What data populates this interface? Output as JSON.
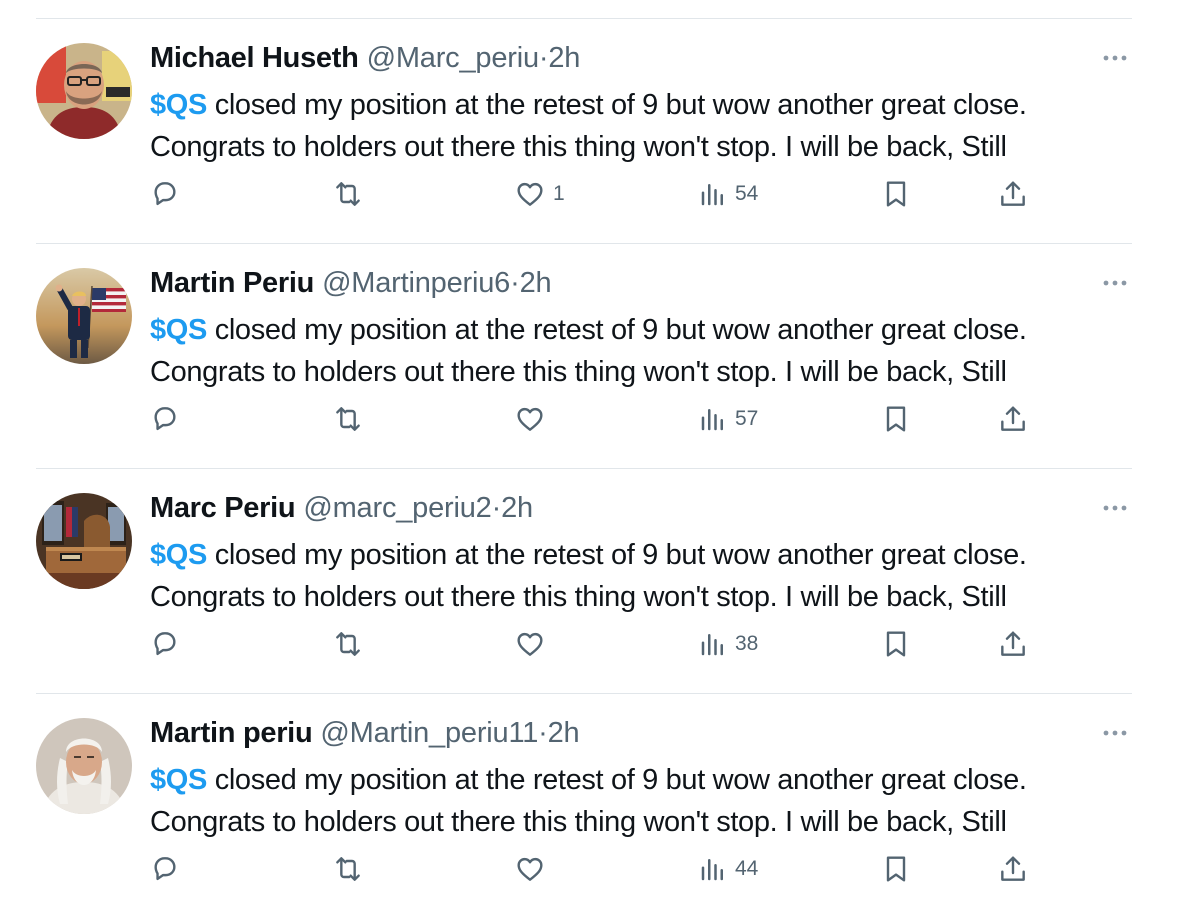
{
  "colors": {
    "accent": "#1d9bf0",
    "text": "#0f1419",
    "secondary": "#536471",
    "divider": "#e1e6ea"
  },
  "tweets": [
    {
      "name": "Michael Huseth",
      "handle": "@Marc_periu",
      "separator": "·",
      "time": "2h",
      "cashtag": "$QS",
      "text_line1": " closed my position at the retest of 9 but wow another great close.",
      "text_line2": "Congrats to holders out there this thing won't stop. I will be back, Still",
      "likes": "1",
      "views": "54",
      "avatar_icon": "avatar-man-glasses"
    },
    {
      "name": "Martin Periu",
      "handle": "@Martinperiu6",
      "separator": "·",
      "time": "2h",
      "cashtag": "$QS",
      "text_line1": " closed my position at the retest of 9 but wow another great close.",
      "text_line2": "Congrats to holders out there this thing won't stop. I will be back, Still",
      "likes": "",
      "views": "57",
      "avatar_icon": "avatar-man-with-flag"
    },
    {
      "name": "Marc Periu",
      "handle": "@marc_periu2",
      "separator": "·",
      "time": "2h",
      "cashtag": "$QS",
      "text_line1": " closed my position at the retest of 9 but wow another great close.",
      "text_line2": "Congrats to holders out there this thing won't stop. I will be back, Still",
      "likes": "",
      "views": "38",
      "avatar_icon": "avatar-office-room"
    },
    {
      "name": "Martin periu",
      "handle": "@Martin_periu11",
      "separator": "·",
      "time": "2h",
      "cashtag": "$QS",
      "text_line1": " closed my position at the retest of 9 but wow another great close.",
      "text_line2": "Congrats to holders out there this thing won't stop. I will be back, Still",
      "likes": "",
      "views": "44",
      "avatar_icon": "avatar-old-man-white-hair"
    }
  ]
}
